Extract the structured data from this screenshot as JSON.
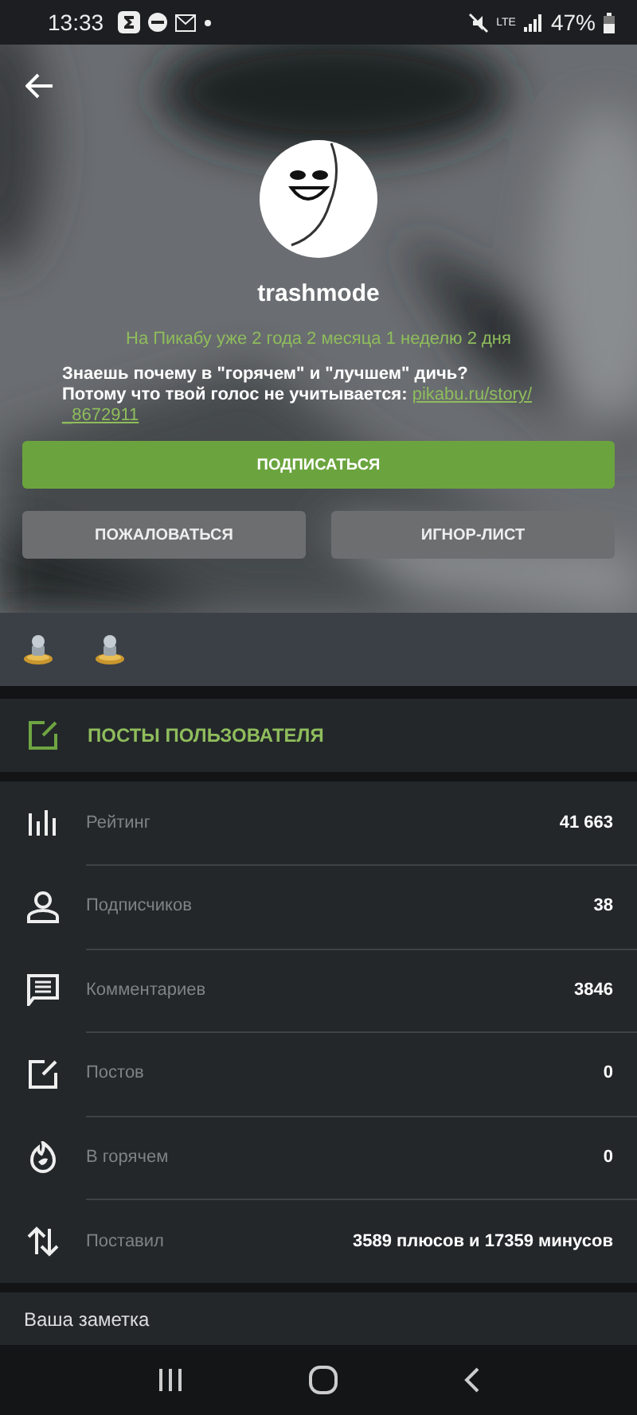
{
  "status_bar": {
    "time": "13:33",
    "battery": "47%",
    "network": "LTE"
  },
  "profile": {
    "username": "trashmode",
    "member_since": "На Пикабу уже 2 года 2 месяца 1 неделю 2 дня",
    "bio": "Знаешь почему в \"горячем\" и \"лучшем\" дичь?\nПотому что твой голос не учитывается: ",
    "bio_link_parts": [
      "pikabu.ru/story/",
      "_8672911"
    ]
  },
  "buttons": {
    "subscribe": "ПОДПИСАТЬСЯ",
    "report": "ПОЖАЛОВАТЬСЯ",
    "ignore": "ИГНОР-ЛИСТ"
  },
  "awards": [
    {
      "kind": "trophy"
    },
    {
      "kind": "trophy"
    }
  ],
  "user_posts": "ПОСТЫ ПОЛЬЗОВАТЕЛЯ",
  "stats": [
    {
      "kind": "rating",
      "label": "Рейтинг",
      "value": "41 663"
    },
    {
      "kind": "subscribers",
      "label": "Подписчиков",
      "value": "38"
    },
    {
      "kind": "comments",
      "label": "Комментариев",
      "value": "3846"
    },
    {
      "kind": "posts",
      "label": "Постов",
      "value": "0"
    },
    {
      "kind": "hot",
      "label": "В горячем",
      "value": "0"
    },
    {
      "kind": "votes",
      "label": "Поставил",
      "value": "3589 плюсов и 17359 минусов"
    }
  ],
  "note_title": "Ваша заметка"
}
